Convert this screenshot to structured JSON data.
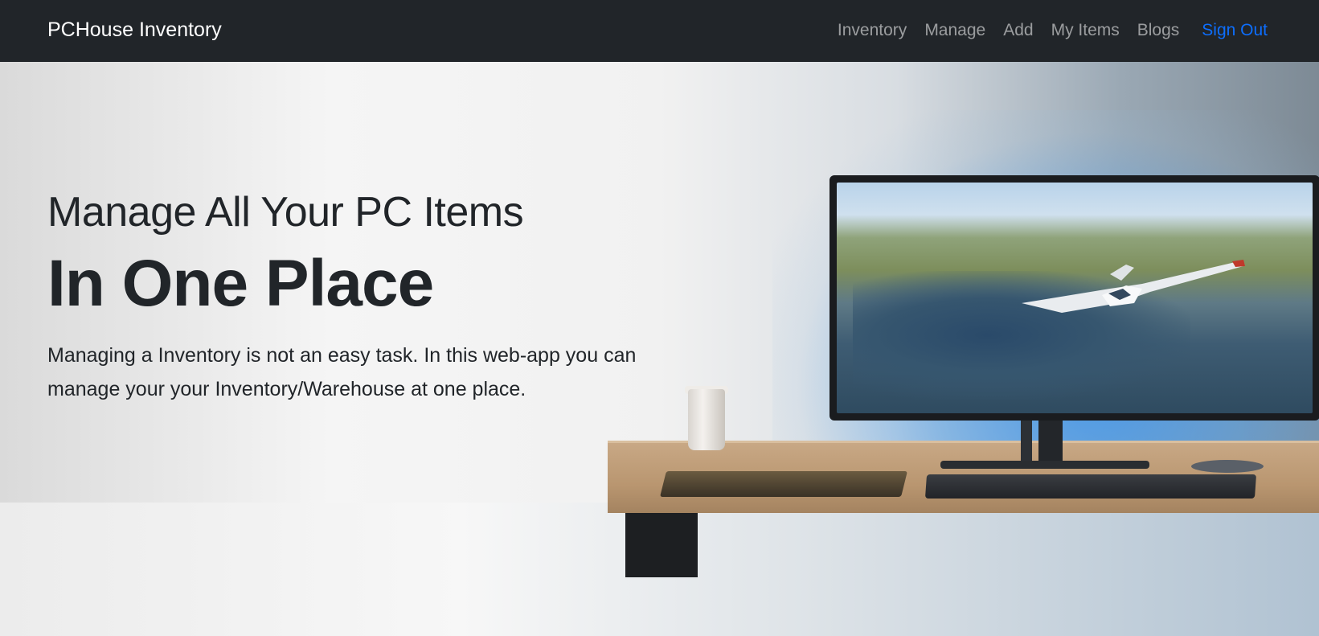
{
  "navbar": {
    "brand": "PCHouse Inventory",
    "links": [
      {
        "label": "Inventory"
      },
      {
        "label": "Manage"
      },
      {
        "label": "Add"
      },
      {
        "label": "My Items"
      },
      {
        "label": "Blogs"
      }
    ],
    "sign_out": "Sign Out"
  },
  "hero": {
    "subtitle": "Manage All Your PC Items",
    "title": "In One Place",
    "description": "Managing a Inventory is not an easy task. In this web-app you can manage your your Inventory/Warehouse at one place."
  },
  "colors": {
    "navbar_bg": "#212529",
    "accent": "#0d6efd"
  }
}
